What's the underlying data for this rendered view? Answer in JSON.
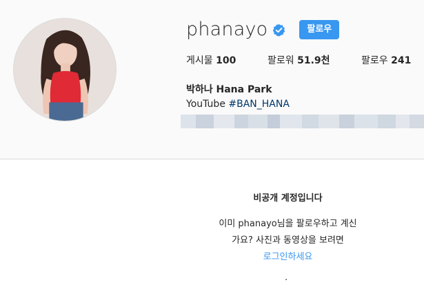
{
  "profile": {
    "username": "phanayo",
    "verified": true,
    "follow_label": "팔로우",
    "stats": {
      "posts_label": "게시물",
      "posts_value": "100",
      "followers_label": "팔로워",
      "followers_value": "51.9천",
      "following_label": "팔로우",
      "following_value": "241"
    },
    "full_name": "박하나 Hana Park",
    "bio_prefix": "YouTube ",
    "bio_hashtag": "#BAN_HANA"
  },
  "private_notice": {
    "title": "비공개 계정입니다",
    "line1": "이미 phanayo님을 팔로우하고 계신",
    "line2": "가요? 사진과 동영상을 보려면",
    "login_link": "로그인하세요",
    "dot": "."
  },
  "colors": {
    "accent": "#3897f0",
    "background": "#fafafa",
    "hashtag": "#003569"
  },
  "icons": {
    "verified": "verified-badge-icon"
  }
}
